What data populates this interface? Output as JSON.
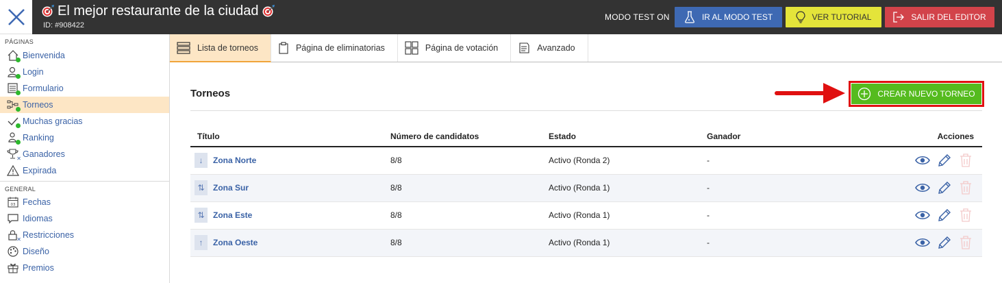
{
  "header": {
    "title": "El mejor restaurante de la ciudad",
    "id_text": "ID: #908422",
    "mode_text": "MODO TEST ON",
    "buttons": {
      "test": "IR AL MODO TEST",
      "tutorial": "VER TUTORIAL",
      "exit": "SALIR DEL EDITOR"
    }
  },
  "colors": {
    "topbar": "#333333",
    "test_button": "#3e69b3",
    "tutorial_button": "#e4e43a",
    "exit_button": "#d2434a",
    "create_button": "#55bb1e",
    "highlight_border": "#e01010",
    "active_bg": "#fde6c5",
    "link": "#3a62a6",
    "status_dot": "#2db82d"
  },
  "sidebar": {
    "pages_label": "PÁGINAS",
    "pages": [
      {
        "label": "Bienvenida",
        "icon": "home-icon"
      },
      {
        "label": "Login",
        "icon": "user-icon"
      },
      {
        "label": "Formulario",
        "icon": "form-icon"
      },
      {
        "label": "Torneos",
        "icon": "bracket-icon",
        "active": true
      },
      {
        "label": "Muchas gracias",
        "icon": "check-icon"
      },
      {
        "label": "Ranking",
        "icon": "ranking-icon"
      },
      {
        "label": "Ganadores",
        "icon": "trophy-icon"
      },
      {
        "label": "Expirada",
        "icon": "warning-icon"
      }
    ],
    "general_label": "GENERAL",
    "general": [
      {
        "label": "Fechas",
        "icon": "calendar-icon"
      },
      {
        "label": "Idiomas",
        "icon": "speech-bubble-icon"
      },
      {
        "label": "Restricciones",
        "icon": "lock-icon"
      },
      {
        "label": "Diseño",
        "icon": "palette-icon"
      },
      {
        "label": "Premios",
        "icon": "gift-icon"
      }
    ]
  },
  "tabs": [
    {
      "label": "Lista de torneos",
      "icon": "list-icon",
      "active": true
    },
    {
      "label": "Página de eliminatorias",
      "icon": "clipboard-icon"
    },
    {
      "label": "Página de votación",
      "icon": "grid-icon"
    },
    {
      "label": "Avanzado",
      "icon": "document-icon"
    }
  ],
  "main": {
    "section_title": "Torneos",
    "create_button": "CREAR NUEVO TORNEO",
    "table": {
      "columns": [
        "Título",
        "Número de candidatos",
        "Estado",
        "Ganador",
        "Acciones"
      ],
      "rows": [
        {
          "title": "Zona Norte",
          "order_icon": "↓",
          "candidates": "8/8",
          "status": "Activo (Ronda 2)",
          "winner": "-"
        },
        {
          "title": "Zona Sur",
          "order_icon": "⇅",
          "candidates": "8/8",
          "status": "Activo (Ronda 1)",
          "winner": "-"
        },
        {
          "title": "Zona Este",
          "order_icon": "⇅",
          "candidates": "8/8",
          "status": "Activo (Ronda 1)",
          "winner": "-"
        },
        {
          "title": "Zona Oeste",
          "order_icon": "↑",
          "candidates": "8/8",
          "status": "Activo (Ronda 1)",
          "winner": "-"
        }
      ]
    }
  }
}
